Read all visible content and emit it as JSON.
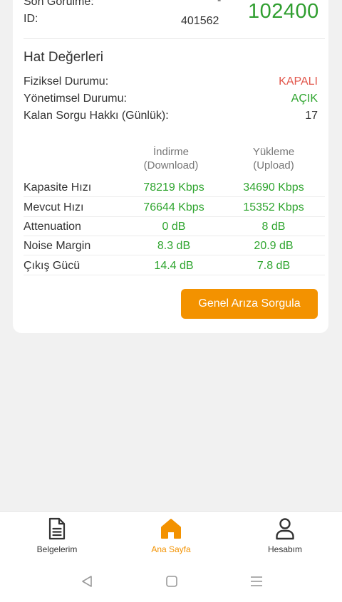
{
  "device": {
    "last_seen_label": "Son Görülme:",
    "last_seen_value": "-",
    "id_label": "ID:",
    "id_value": "401562",
    "big_number": "102400"
  },
  "line_values": {
    "title": "Hat Değerleri",
    "physical_label": "Fiziksel Durumu:",
    "physical_value": "KAPALI",
    "admin_label": "Yönetimsel Durumu:",
    "admin_value": "AÇIK",
    "queries_label": "Kalan Sorgu Hakkı (Günlük):",
    "queries_value": "17"
  },
  "speed_table": {
    "col_download": "İndirme",
    "col_download_sub": "(Download)",
    "col_upload": "Yükleme",
    "col_upload_sub": "(Upload)",
    "rows": [
      {
        "label": "Kapasite Hızı",
        "download": "78219 Kbps",
        "upload": "34690 Kbps"
      },
      {
        "label": "Mevcut Hızı",
        "download": "76644 Kbps",
        "upload": "15352 Kbps"
      },
      {
        "label": "Attenuation",
        "download": "0 dB",
        "upload": "8 dB"
      },
      {
        "label": "Noise Margin",
        "download": "8.3 dB",
        "upload": "20.9 dB"
      },
      {
        "label": "Çıkış Gücü",
        "download": "14.4 dB",
        "upload": "7.8 dB"
      }
    ]
  },
  "actions": {
    "fault_query_label": "Genel Arıza Sorgula"
  },
  "tabbar": {
    "items": [
      {
        "label": "Belgelerim",
        "icon": "document-icon",
        "active": false
      },
      {
        "label": "Ana Sayfa",
        "icon": "home-icon",
        "active": true
      },
      {
        "label": "Hesabım",
        "icon": "user-icon",
        "active": false
      }
    ]
  },
  "colors": {
    "accent": "#f39200",
    "positive": "#2fa52f",
    "negative": "#e2574c"
  }
}
